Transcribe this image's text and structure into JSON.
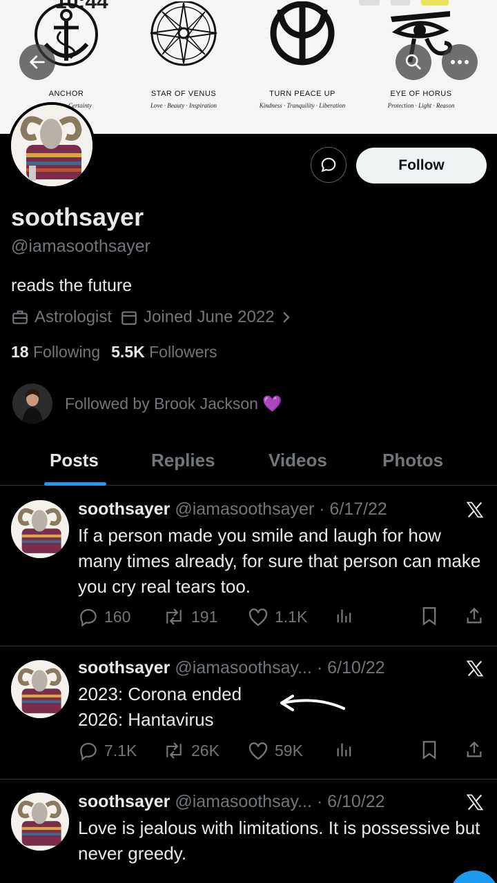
{
  "status_bar": {
    "time": "10:44"
  },
  "banner": {
    "symbols": [
      {
        "caption": "ANCHOR",
        "subtitle": "Certainty",
        "icon": "anchor-icon"
      },
      {
        "caption": "STAR OF VENUS",
        "subtitle": "Love · Beauty · Inspiration",
        "icon": "compass-star-icon"
      },
      {
        "caption": "TURN PEACE UP",
        "subtitle": "Kindness · Tranquility · Liberation",
        "icon": "peace-icon"
      },
      {
        "caption": "EYE OF HORUS",
        "subtitle": "Protection · Light · Reason",
        "icon": "eye-of-horus-icon"
      }
    ]
  },
  "header_buttons": {
    "back": "back-arrow-icon",
    "search": "search-icon",
    "more": "more-icon"
  },
  "profile": {
    "name": "soothsayer",
    "handle": "@iamasoothsayer",
    "bio": "reads the future",
    "profession": "Astrologist",
    "joined": "Joined June 2022",
    "following_count": "18",
    "following_label": "Following",
    "followers_count": "5.5K",
    "followers_label": "Followers",
    "followed_by": "Followed by Brook Jackson 💜",
    "follow_button": "Follow"
  },
  "tabs": [
    "Posts",
    "Replies",
    "Videos",
    "Photos"
  ],
  "posts": [
    {
      "name": "soothsayer",
      "meta": "@iamasoothsayer · 6/17/22",
      "text": "If a person made you smile and laugh for how many times already, for sure that person can make you cry real tears too.",
      "replies": "160",
      "reposts": "191",
      "likes": "1.1K"
    },
    {
      "name": "soothsayer",
      "meta": "@iamasoothsay... · 6/10/22",
      "line1": "2023: Corona ended",
      "line2": "2026: Hantavirus",
      "replies": "7.1K",
      "reposts": "26K",
      "likes": "59K"
    },
    {
      "name": "soothsayer",
      "meta": "@iamasoothsay... · 6/10/22",
      "text": "Love is jealous with limitations. It is possessive but never greedy."
    }
  ],
  "colors": {
    "accent": "#1d9bf0",
    "text": "#e7e9ea",
    "muted": "#71767b",
    "divider": "#2f3336",
    "heart": "#8b3dff"
  }
}
